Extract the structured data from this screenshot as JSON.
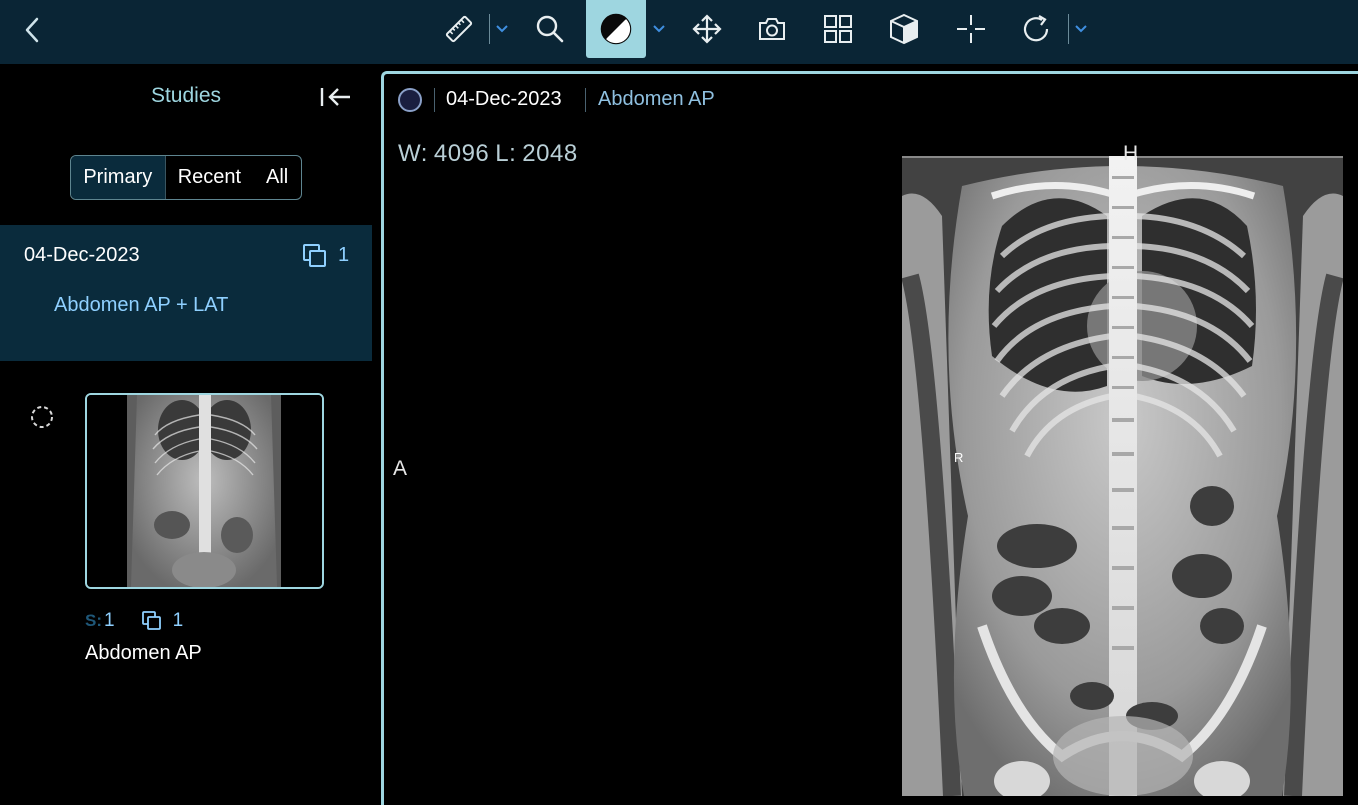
{
  "toolbar": {
    "back_icon": "chevron-left-icon",
    "tools": [
      {
        "name": "measure",
        "icon": "ruler-icon",
        "has_menu": true
      },
      {
        "name": "zoom",
        "icon": "magnifier-icon",
        "has_menu": false
      },
      {
        "name": "window-level",
        "icon": "contrast-icon",
        "has_menu": true,
        "active": true
      },
      {
        "name": "pan",
        "icon": "move-arrows-icon",
        "has_menu": false
      },
      {
        "name": "capture",
        "icon": "camera-icon",
        "has_menu": false
      },
      {
        "name": "layout",
        "icon": "grid-layout-icon",
        "has_menu": false
      },
      {
        "name": "3d",
        "icon": "cube-icon",
        "has_menu": false
      },
      {
        "name": "crosshair",
        "icon": "crosshair-icon",
        "has_menu": false
      },
      {
        "name": "rotate",
        "icon": "rotate-icon",
        "has_menu": true
      }
    ]
  },
  "sidebar": {
    "title": "Studies",
    "collapse_icon": "collapse-left-icon",
    "filters": [
      "Primary",
      "Recent",
      "All"
    ],
    "active_filter": "Primary",
    "study": {
      "date": "04-Dec-2023",
      "series_count": "1",
      "description": "Abdomen AP + LAT"
    },
    "series": {
      "s_label": "S:",
      "s_value": "1",
      "instances": "1",
      "name": "Abdomen AP"
    }
  },
  "viewport": {
    "date": "04-Dec-2023",
    "description": "Abdomen AP",
    "w_label": "W:",
    "w_value": "4096",
    "l_label": "L:",
    "l_value": "2048",
    "orientation_top": "H",
    "orientation_left": "A",
    "marker": "R"
  },
  "colors": {
    "toolbar_bg": "#0a2535",
    "accent": "#9ed6e0",
    "link": "#8fd0ff",
    "selected_bg": "#0a2b3c"
  }
}
